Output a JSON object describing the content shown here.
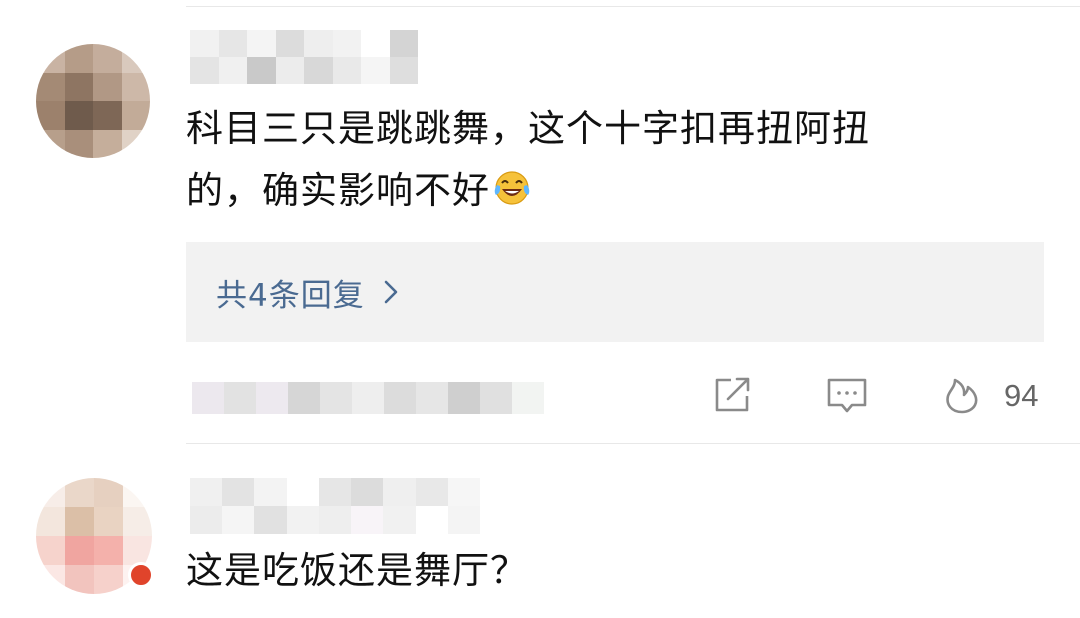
{
  "comments": [
    {
      "text_line1": "科目三只是跳跳舞，这个十字扣再扭阿扭",
      "text_line2": "的，确实影响不好",
      "emoji": "laughing-tears-emoji",
      "replies_label": "共4条回复",
      "like_count": "94"
    },
    {
      "text_line1": "这是吃饭还是舞厅？"
    }
  ],
  "colors": {
    "link": "#4a6a91",
    "text": "#111111",
    "meta": "#666666",
    "reply_bg": "#f2f2f2",
    "icon": "#8a8a8a"
  },
  "icons": [
    "share-icon",
    "comment-icon",
    "flame-like-icon",
    "chevron-right-icon"
  ]
}
